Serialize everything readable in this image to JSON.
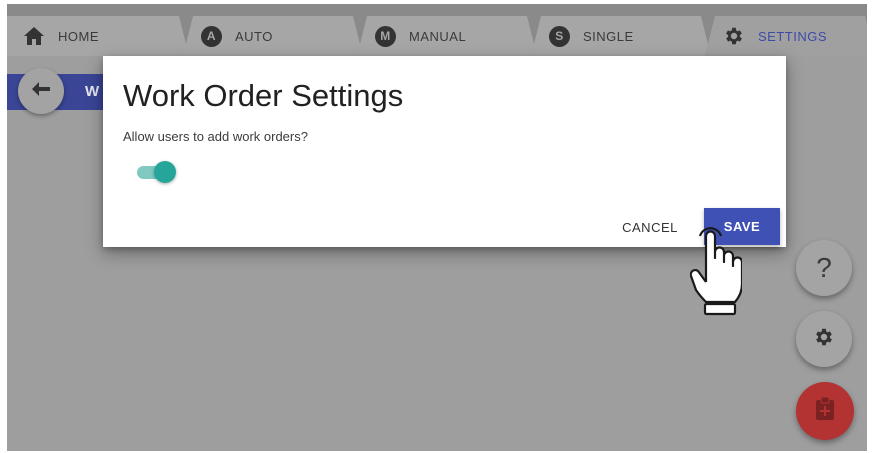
{
  "tabs": [
    {
      "label": "HOME",
      "icon": "home-icon"
    },
    {
      "label": "AUTO",
      "icon": "A"
    },
    {
      "label": "MANUAL",
      "icon": "M"
    },
    {
      "label": "SINGLE",
      "icon": "S"
    },
    {
      "label": "SETTINGS",
      "icon": "gear-icon",
      "active": true
    }
  ],
  "page": {
    "header_partial": "W"
  },
  "dialog": {
    "title": "Work Order Settings",
    "question": "Allow users to add work orders?",
    "toggle_on": true,
    "cancel_label": "CANCEL",
    "save_label": "SAVE"
  },
  "fabs": {
    "help_label": "?"
  },
  "colors": {
    "accent": "#3f51b5",
    "toggle": "#26a69a",
    "add_button": "#b33232",
    "overlay": "#9e9e9e"
  }
}
